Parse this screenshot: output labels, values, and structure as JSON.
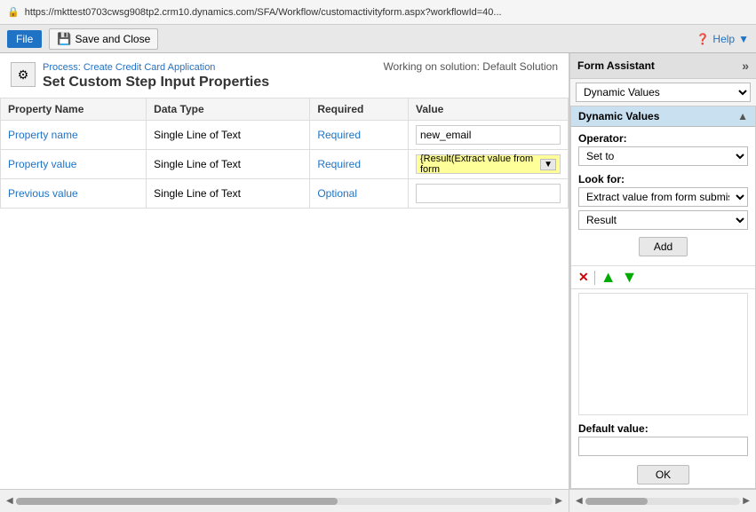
{
  "addressBar": {
    "url": "https://mkttest0703cwsg908tp2.crm10.dynamics.com/SFA/Workflow/customactivityform.aspx?workflowId=40..."
  },
  "toolbar": {
    "fileLabel": "File",
    "saveCloseLabel": "Save and Close",
    "helpLabel": "Help",
    "helpIcon": "?"
  },
  "processHeader": {
    "processLink": "Process: Create Credit Card Application",
    "pageTitle": "Set Custom Step Input Properties",
    "solutionText": "Working on solution: Default Solution",
    "iconSymbol": "⚙"
  },
  "table": {
    "columns": [
      "Property Name",
      "Data Type",
      "Required",
      "Value"
    ],
    "rows": [
      {
        "propertyName": "Property name",
        "dataType": "Single Line of Text",
        "required": "Required",
        "valueType": "text",
        "value": "new_email"
      },
      {
        "propertyName": "Property value",
        "dataType": "Single Line of Text",
        "required": "Required",
        "valueType": "dynamic",
        "value": "{Result(Extract value from form"
      },
      {
        "propertyName": "Previous value",
        "dataType": "Single Line of Text",
        "required": "Optional",
        "valueType": "text",
        "value": ""
      }
    ]
  },
  "formAssistant": {
    "title": "Form Assistant",
    "expandIcon": "»",
    "dropdownOptions": [
      "Dynamic Values"
    ],
    "dropdownSelected": "Dynamic Values",
    "dynamicValues": {
      "title": "Dynamic Values",
      "collapseIcon": "▲",
      "operatorLabel": "Operator:",
      "operatorOptions": [
        "Set to"
      ],
      "operatorSelected": "Set to",
      "lookForLabel": "Look for:",
      "lookForOptions": [
        "Extract value from form submission"
      ],
      "lookForSelected": "Extract value from form submission",
      "resultOptions": [
        "Result"
      ],
      "resultSelected": "Result",
      "addButtonLabel": "Add",
      "deleteIcon": "✕",
      "upIcon": "▲",
      "downIcon": "▼",
      "defaultValueLabel": "Default value:",
      "defaultValue": "",
      "okButtonLabel": "OK"
    }
  }
}
